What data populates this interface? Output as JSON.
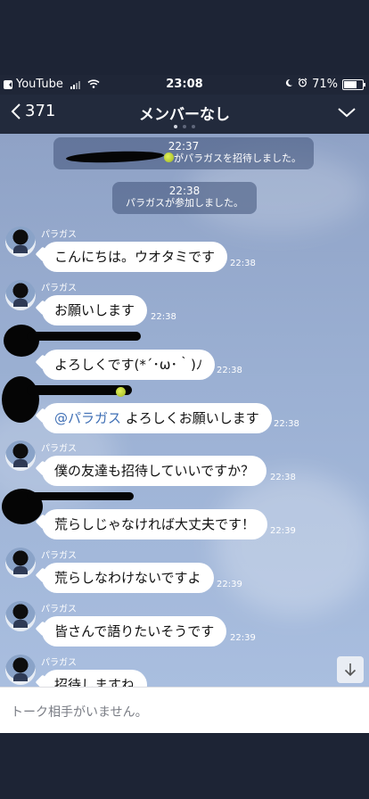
{
  "status_bar": {
    "back_app": "YouTube",
    "time": "23:08",
    "battery": "71%",
    "battery_level": 0.71
  },
  "nav": {
    "back_count": "371",
    "title": "メンバーなし"
  },
  "messages": {
    "sys1_time": "22:37",
    "sys1_text": "がパラガスを招待しました。",
    "sys2_time": "22:38",
    "sys2_text": "パラガスが参加しました。",
    "m1_sender": "パラガス",
    "m1_text": "こんにちは。ウオタミです",
    "m1_time": "22:38",
    "m2_sender": "パラガス",
    "m2_text": "お願いします",
    "m2_time": "22:38",
    "m3_text": "よろしくです(*´･ω･｀)ﾉ",
    "m3_time": "22:38",
    "m4_mention": "@パラガス",
    "m4_text": " よろしくお願いします",
    "m4_time": "22:38",
    "m5_sender": "パラガス",
    "m5_text": "僕の友達も招待していいですか？",
    "m5_time": "22:38",
    "m6_text": "荒らしじゃなければ大丈夫です！",
    "m6_time": "22:39",
    "m7_sender": "パラガス",
    "m7_text": "荒らしなわけないですよ",
    "m7_time": "22:39",
    "m8_sender": "パラガス",
    "m8_text": "皆さんで語りたいそうです",
    "m8_time": "22:39",
    "m9_sender": "パラガス",
    "m9_text": "招待しますね"
  },
  "input": {
    "placeholder": "トーク相手がいません。"
  },
  "colors": {
    "nav_bg": "#222a3c",
    "chat_bg": "#9bb0d3",
    "mention": "#3f6fb5"
  }
}
